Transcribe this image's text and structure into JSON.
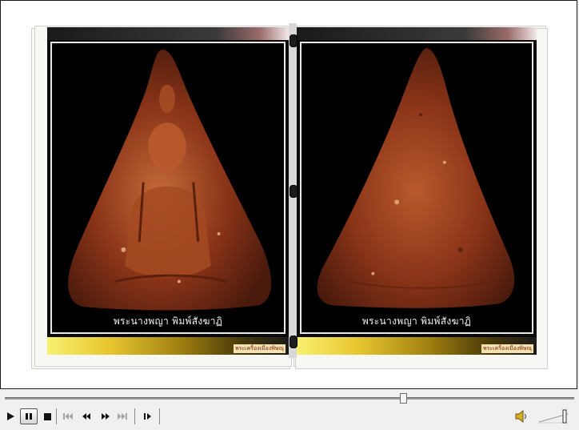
{
  "viewer": {
    "left_page": {
      "caption": "พระนางพญา พิมพ์สังฆาฏิ",
      "stamp": "พระเครื่องเมืองพิษณุ",
      "image": "amulet-front-image"
    },
    "right_page": {
      "caption": "พระนางพญา พิมพ์สังฆาฏิ",
      "stamp": "พระเครื่องเมืองพิษณุ",
      "image": "amulet-back-image"
    }
  },
  "player": {
    "seek_progress": 0.7,
    "controls": [
      {
        "name": "play-button",
        "icon": "play-icon",
        "glyph": "▶",
        "enabled": true
      },
      {
        "name": "pause-button",
        "icon": "pause-icon",
        "glyph": "❚❚",
        "enabled": true,
        "pressed": true
      },
      {
        "name": "stop-button",
        "icon": "stop-icon",
        "glyph": "■",
        "enabled": true
      },
      {
        "name": "previous-button",
        "icon": "skip-back-icon",
        "glyph": "⏮",
        "enabled": false
      },
      {
        "name": "rewind-button",
        "icon": "rewind-icon",
        "glyph": "◀◀",
        "enabled": true
      },
      {
        "name": "fast-forward-button",
        "icon": "fast-forward-icon",
        "glyph": "▶▶",
        "enabled": true
      },
      {
        "name": "next-button",
        "icon": "skip-forward-icon",
        "glyph": "⏭",
        "enabled": false
      },
      {
        "name": "frame-step-button",
        "icon": "frame-step-icon",
        "glyph": "▮▶",
        "enabled": true
      }
    ],
    "volume_icon": "speaker-icon",
    "volume_level": 0.9
  },
  "colors": {
    "amulet": "#8a3418",
    "amulet_highlight": "#c46a38",
    "page_background": "#0a0a0a",
    "gold_band": "#e8c830"
  }
}
